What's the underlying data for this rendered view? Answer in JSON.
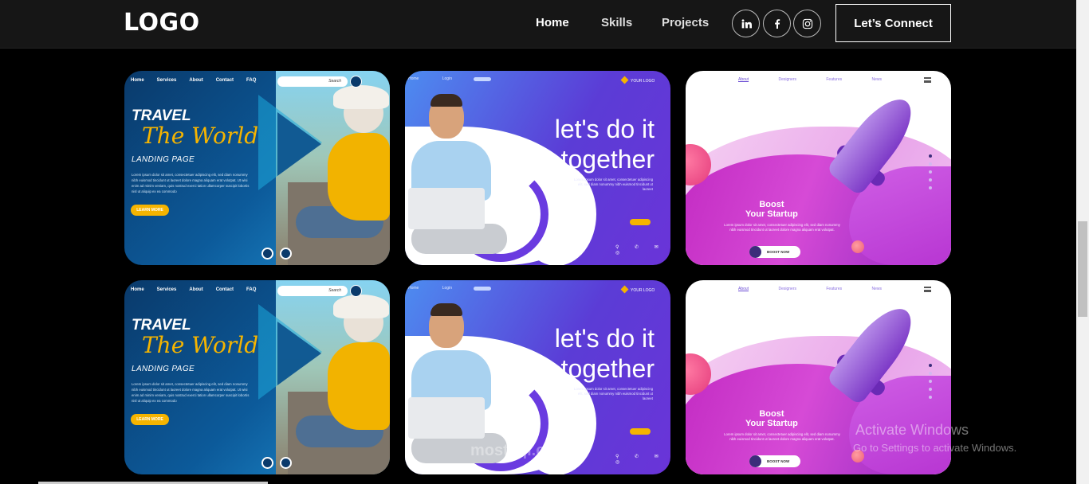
{
  "header": {
    "logo": "LOGO",
    "nav": [
      "Home",
      "Skills",
      "Projects"
    ],
    "social": [
      "linkedin-icon",
      "facebook-icon",
      "instagram-icon"
    ],
    "cta": "Let’s Connect"
  },
  "travel": {
    "nav": [
      "Home",
      "Services",
      "About",
      "Contact",
      "FAQ"
    ],
    "search_placeholder": "Search",
    "title1": "TRAVEL",
    "title2": "The World",
    "subtitle": "LANDING PAGE",
    "body": "Lorem ipsum dolor sit amet, consectetuer adipiscing elit, sed diam nonummy nibh euismod tincidunt ut laoreet dolore magna aliquam erat volutpat. Ut wisi enim ad minim veniam, quis nostrud exerci tation ullamcorper suscipit lobortis nisl ut aliquip ex ea commodo",
    "button": "LEARN MORE"
  },
  "together": {
    "nav": [
      "Home",
      "Login"
    ],
    "brand": "YOUR LOGO",
    "heading_line1": "let's do it",
    "heading_line2": "together",
    "body": "Lorem ipsum dolor sit amet, consectetuer adipiscing elit, sed diam nonummy nibh euismod tincidunt ut laoreet",
    "icons": "⚲ ✆ ✉ ◎"
  },
  "boost": {
    "nav": [
      "About",
      "Designers",
      "Features",
      "News"
    ],
    "heading_line1": "Boost",
    "heading_line2": "Your Startup",
    "body": "Lorem ipsum dolor sit amet, consectetuer adipiscing elit, sed diam nonummy nibh euismod tincidunt ut laoreet dolore magna aliquam erat volutpat.",
    "button": "BOOST NOW"
  },
  "overlay": {
    "activate_title": "Activate Windows",
    "activate_sub": "Go to Settings to activate Windows.",
    "watermark": "mostaql.com"
  }
}
